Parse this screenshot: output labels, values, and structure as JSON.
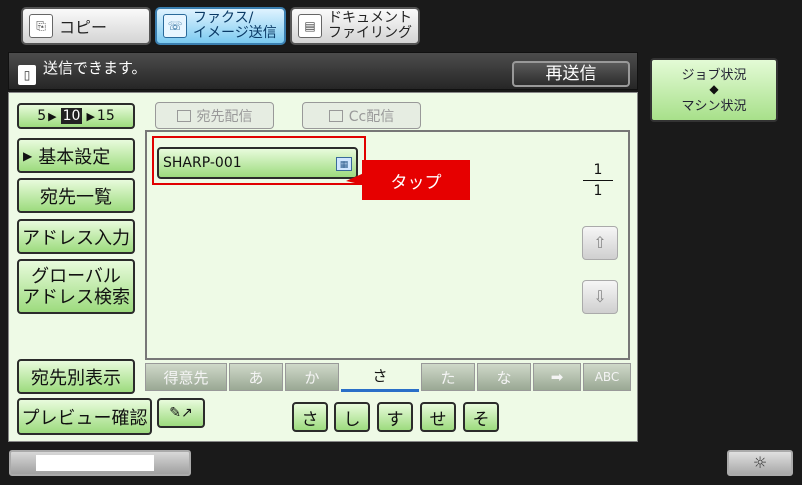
{
  "mode_tabs": [
    {
      "label": "コピー",
      "icon": "copy-icon"
    },
    {
      "label": "ファクス/\nイメージ送信",
      "line1": "ファクス/",
      "line2": "イメージ送信",
      "icon": "fax-icon",
      "active": true
    },
    {
      "label": "ドキュメント\nファイリング",
      "line1": "ドキュメント",
      "line2": "ファイリング",
      "icon": "filing-icon"
    }
  ],
  "status": {
    "message": "送信できます。",
    "resend_label": "再送信"
  },
  "job_status": {
    "line1": "ジョブ状況",
    "arrows": "◆",
    "line2": "マシン状況"
  },
  "pager": {
    "prev": "5",
    "current": "10",
    "next": "15"
  },
  "dest_buttons": {
    "broadcast": "宛先配信",
    "cc": "Cc配信"
  },
  "sidebar": {
    "basic_settings": "基本設定",
    "address_list": "宛先一覧",
    "address_entry": "アドレス入力",
    "global_search_line1": "グローバル",
    "global_search_line2": "アドレス検索",
    "show_by_dest": "宛先別表示",
    "preview_confirm": "プレビュー確認"
  },
  "entry": {
    "name": "SHARP-001"
  },
  "callout": {
    "text": "タップ"
  },
  "page_count": {
    "current": "1",
    "total": "1"
  },
  "kana_tabs": [
    "得意先",
    "あ",
    "か",
    "さ",
    "た",
    "な",
    "➡",
    "ABC"
  ],
  "active_kana_tab": "さ",
  "char_buttons": [
    "さ",
    "し",
    "す",
    "せ",
    "そ"
  ],
  "colors": {
    "accent_green": "#9ddb7e",
    "highlight_red": "#e00000",
    "active_tab_blue": "#7ccaf0"
  }
}
